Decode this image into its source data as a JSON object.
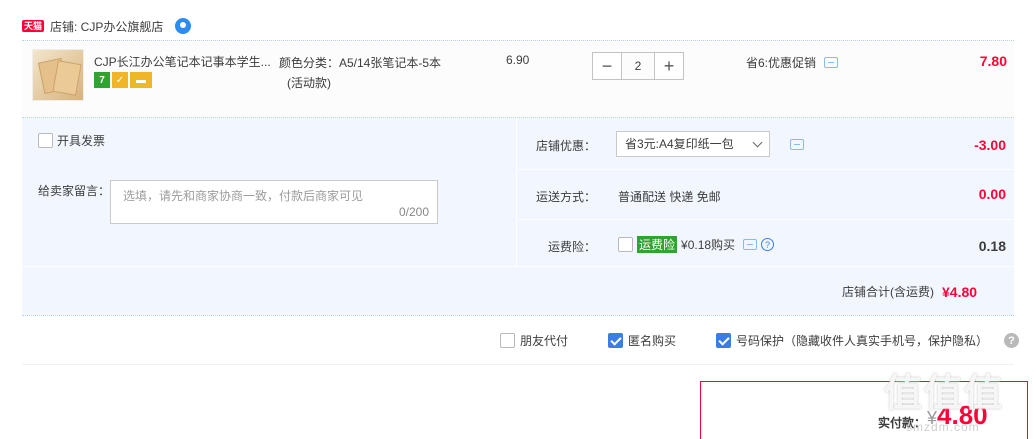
{
  "shop": {
    "badge": "天猫",
    "label": "店铺: CJP办公旗舰店"
  },
  "item": {
    "title": "CJP长江办公笔记本记事本学生...",
    "badges": [
      "7",
      "",
      ""
    ],
    "spec_line1": "颜色分类：A5/14张笔记本-5本",
    "spec_line2": "(活动款)",
    "unit_price": "6.90",
    "qty_minus": "−",
    "qty_value": "2",
    "qty_plus": "+",
    "promo": "省6:优惠促销",
    "total": "7.80"
  },
  "extras": {
    "invoice_label": "开具发票",
    "note_label": "给卖家留言：",
    "note_placeholder": "选填，请先和商家协商一致，付款后商家可见",
    "note_count": "0/200",
    "shop_discount_label": "店铺优惠：",
    "shop_discount_value": "省3元:A4复印纸一包",
    "shop_discount_amount": "-3.00",
    "shipping_label": "运送方式：",
    "shipping_value": "普通配送 快递 免邮",
    "shipping_amount": "0.00",
    "insurance_label": "运费险：",
    "insurance_badge": "运费险",
    "insurance_value": "¥0.18购买",
    "insurance_amount": "0.18",
    "shop_total_label": "店铺合计(含运费)",
    "shop_total_value": "¥4.80"
  },
  "options": {
    "friend_pay": "朋友代付",
    "anonymous": "匿名购买",
    "number_protect": "号码保护（隐藏收件人真实手机号，保护隐私）"
  },
  "payment": {
    "label": "实付款：",
    "currency": "¥",
    "amount": "4.80"
  },
  "watermark": {
    "text": "值值值",
    "url": "smzdm.com"
  },
  "colors": {
    "accent": "#ff0036",
    "blue": "#3b7ce6",
    "panel": "#f2f7ff"
  }
}
